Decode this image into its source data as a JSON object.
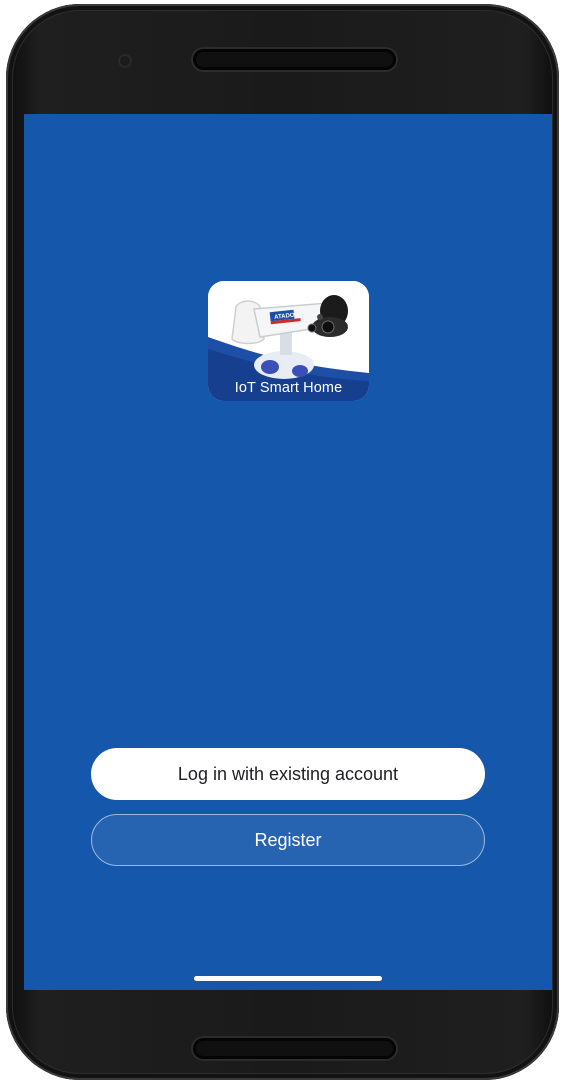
{
  "app": {
    "logo_caption": "IoT Smart Home",
    "logo_badge": "ATADO"
  },
  "actions": {
    "login_label": "Log in with existing account",
    "register_label": "Register"
  },
  "colors": {
    "background": "#1558ab",
    "login_button_bg": "#ffffff",
    "register_button_bg": "#2664b1"
  },
  "icons": {
    "app_logo": "security-camera-robot-icon"
  }
}
